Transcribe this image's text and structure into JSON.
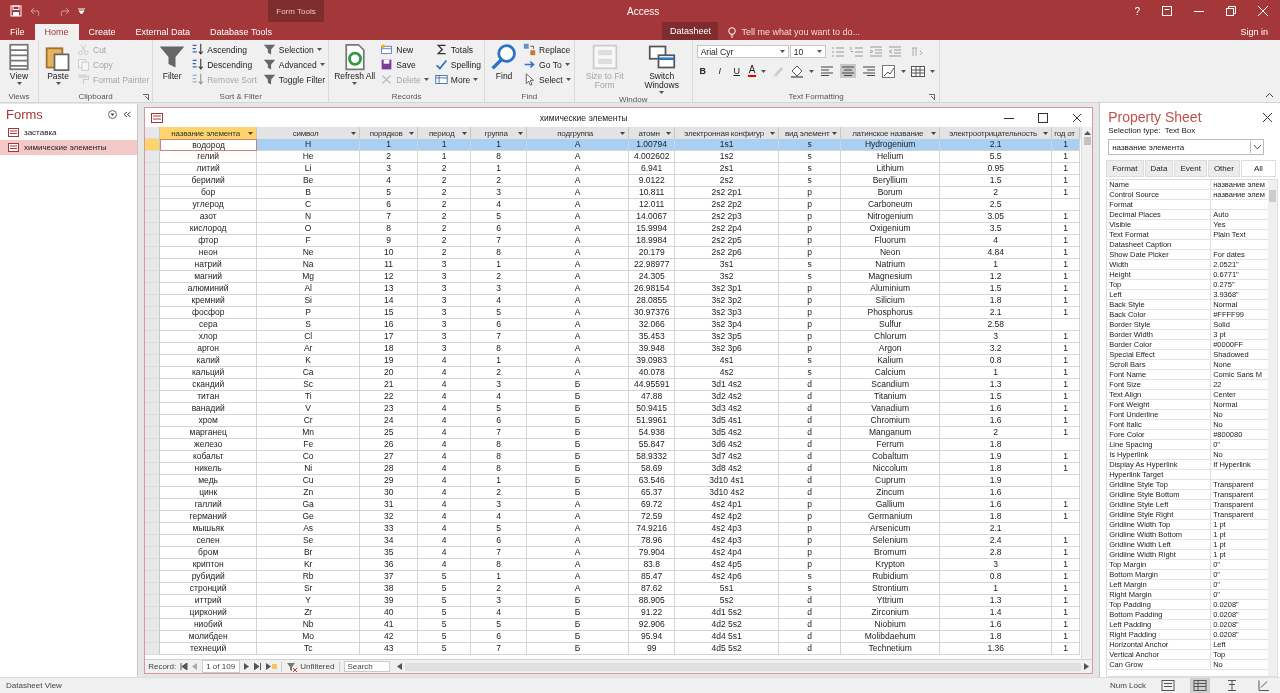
{
  "window": {
    "title": "Access",
    "context_header": "Form Tools",
    "sign_in": "Sign in",
    "help": "?"
  },
  "tabs": [
    {
      "label": "File",
      "selected": false,
      "kind": "plain"
    },
    {
      "label": "Home",
      "selected": true,
      "kind": "plain"
    },
    {
      "label": "Create",
      "selected": false,
      "kind": "plain"
    },
    {
      "label": "External Data",
      "selected": false,
      "kind": "plain"
    },
    {
      "label": "Database Tools",
      "selected": false,
      "kind": "plain"
    },
    {
      "label": "Datasheet",
      "selected": false,
      "kind": "context"
    }
  ],
  "tell_me": {
    "placeholder": "Tell me what you want to do..."
  },
  "ribbon": {
    "groups": [
      {
        "label": "Views",
        "launcher": false,
        "items": [
          {
            "kind": "large",
            "label": "View",
            "menu": true,
            "disabled": false
          }
        ]
      },
      {
        "label": "Clipboard",
        "launcher": true,
        "items": [
          {
            "kind": "large",
            "label": "Paste",
            "menu": true,
            "disabled": false
          },
          {
            "kind": "small",
            "label": "Cut",
            "menu": false,
            "disabled": true
          },
          {
            "kind": "small",
            "label": "Copy",
            "menu": false,
            "disabled": true
          },
          {
            "kind": "small",
            "label": "Format Painter",
            "menu": false,
            "disabled": true
          }
        ]
      },
      {
        "label": "Sort & Filter",
        "launcher": false,
        "items": [
          {
            "kind": "large",
            "label": "Filter",
            "menu": false,
            "disabled": false
          },
          {
            "kind": "small",
            "label": "Ascending",
            "menu": false,
            "disabled": false
          },
          {
            "kind": "small",
            "label": "Descending",
            "menu": false,
            "disabled": false
          },
          {
            "kind": "small",
            "label": "Remove Sort",
            "menu": false,
            "disabled": true
          },
          {
            "kind": "small",
            "label": "Selection",
            "menu": true,
            "disabled": false
          },
          {
            "kind": "small",
            "label": "Advanced",
            "menu": true,
            "disabled": false
          },
          {
            "kind": "small",
            "label": "Toggle Filter",
            "menu": false,
            "disabled": false
          }
        ]
      },
      {
        "label": "Records",
        "launcher": false,
        "items": [
          {
            "kind": "large",
            "label": "Refresh All",
            "menu": true,
            "disabled": false
          },
          {
            "kind": "small",
            "label": "New",
            "menu": false,
            "disabled": false
          },
          {
            "kind": "small",
            "label": "Save",
            "menu": false,
            "disabled": false
          },
          {
            "kind": "small",
            "label": "Delete",
            "menu": true,
            "disabled": true
          },
          {
            "kind": "small",
            "label": "Totals",
            "menu": false,
            "disabled": false
          },
          {
            "kind": "small",
            "label": "Spelling",
            "menu": false,
            "disabled": false
          },
          {
            "kind": "small",
            "label": "More",
            "menu": true,
            "disabled": false
          }
        ]
      },
      {
        "label": "Find",
        "launcher": false,
        "items": [
          {
            "kind": "large",
            "label": "Find",
            "menu": false,
            "disabled": false
          },
          {
            "kind": "small",
            "label": "Replace",
            "menu": false,
            "disabled": false
          },
          {
            "kind": "small",
            "label": "Go To",
            "menu": true,
            "disabled": false
          },
          {
            "kind": "small",
            "label": "Select",
            "menu": true,
            "disabled": false
          }
        ]
      },
      {
        "label": "Window",
        "launcher": false,
        "items": [
          {
            "kind": "large",
            "label": "Size to Fit Form",
            "menu": false,
            "disabled": true
          },
          {
            "kind": "large",
            "label": "Switch Windows",
            "menu": true,
            "disabled": false
          }
        ]
      }
    ],
    "text_formatting": {
      "label": "Text Formatting",
      "launcher": true,
      "font": "Arial Cyr",
      "size": "10",
      "styles": [
        "B",
        "I",
        "U"
      ],
      "font_color_button": "A",
      "alignments": [
        {
          "selected": false
        },
        {
          "selected": true
        },
        {
          "selected": false
        }
      ]
    }
  },
  "nav_pane": {
    "title": "Forms",
    "items": [
      {
        "label": "заставка",
        "selected": false
      },
      {
        "label": "химические элементы",
        "selected": true
      }
    ]
  },
  "document": {
    "title": "химические элементы",
    "columns": [
      {
        "label": "название элемента",
        "selected": true
      },
      {
        "label": "символ",
        "selected": false
      },
      {
        "label": "порядков",
        "selected": false
      },
      {
        "label": "период",
        "selected": false
      },
      {
        "label": "группа",
        "selected": false
      },
      {
        "label": "подгруппа",
        "selected": false
      },
      {
        "label": "атомн",
        "selected": false
      },
      {
        "label": "электронная конфигур",
        "selected": false
      },
      {
        "label": "вид элемент",
        "selected": false
      },
      {
        "label": "латинское название",
        "selected": false
      },
      {
        "label": "электроотрицательность",
        "selected": false
      },
      {
        "label": "год от",
        "selected": false
      }
    ],
    "rows": [
      {
        "selected": true,
        "cells": [
          "водород",
          "H",
          "1",
          "1",
          "1",
          "А",
          "1.00794",
          "1s1",
          "s",
          "Hydrogenium",
          "2.1",
          "1"
        ]
      },
      {
        "selected": false,
        "cells": [
          "гелий",
          "He",
          "2",
          "1",
          "8",
          "А",
          "4.002602",
          "1s2",
          "s",
          "Helium",
          "5.5",
          "1"
        ]
      },
      {
        "selected": false,
        "cells": [
          "литий",
          "Li",
          "3",
          "2",
          "1",
          "А",
          "6.941",
          "2s1",
          "s",
          "Lithium",
          "0.95",
          "1"
        ]
      },
      {
        "selected": false,
        "cells": [
          "берилий",
          "Be",
          "4",
          "2",
          "2",
          "А",
          "9.0122",
          "2s2",
          "s",
          "Beryllium",
          "1.5",
          "1"
        ]
      },
      {
        "selected": false,
        "cells": [
          "бор",
          "B",
          "5",
          "2",
          "3",
          "А",
          "10.811",
          "2s2 2p1",
          "p",
          "Borum",
          "2",
          "1"
        ]
      },
      {
        "selected": false,
        "cells": [
          "углерод",
          "C",
          "6",
          "2",
          "4",
          "А",
          "12.011",
          "2s2 2p2",
          "p",
          "Carboneum",
          "2.5",
          null
        ]
      },
      {
        "selected": false,
        "cells": [
          "азот",
          "N",
          "7",
          "2",
          "5",
          "А",
          "14.0067",
          "2s2 2p3",
          "p",
          "Nitrogenium",
          "3.05",
          "1"
        ]
      },
      {
        "selected": false,
        "cells": [
          "кислород",
          "O",
          "8",
          "2",
          "6",
          "А",
          "15.9994",
          "2s2 2p4",
          "p",
          "Oxigenium",
          "3.5",
          "1"
        ]
      },
      {
        "selected": false,
        "cells": [
          "фтор",
          "F",
          "9",
          "2",
          "7",
          "А",
          "18.9984",
          "2s2 2p5",
          "p",
          "Fluorum",
          "4",
          "1"
        ]
      },
      {
        "selected": false,
        "cells": [
          "неон",
          "Ne",
          "10",
          "2",
          "8",
          "А",
          "20.179",
          "2s2 2p6",
          "p",
          "Neon",
          "4.84",
          "1"
        ]
      },
      {
        "selected": false,
        "cells": [
          "натрий",
          "Na",
          "11",
          "3",
          "1",
          "А",
          "22.98977",
          "3s1",
          "s",
          "Natrium",
          "1",
          "1"
        ]
      },
      {
        "selected": false,
        "cells": [
          "магний",
          "Mg",
          "12",
          "3",
          "2",
          "А",
          "24.305",
          "3s2",
          "s",
          "Magnesium",
          "1.2",
          "1"
        ]
      },
      {
        "selected": false,
        "cells": [
          "алюминий",
          "Al",
          "13",
          "3",
          "3",
          "А",
          "26.98154",
          "3s2 3p1",
          "p",
          "Aluminium",
          "1.5",
          "1"
        ]
      },
      {
        "selected": false,
        "cells": [
          "кремний",
          "Si",
          "14",
          "3",
          "4",
          "А",
          "28.0855",
          "3s2 3p2",
          "p",
          "Silicium",
          "1.8",
          "1"
        ]
      },
      {
        "selected": false,
        "cells": [
          "фосфор",
          "P",
          "15",
          "3",
          "5",
          "А",
          "30.97376",
          "3s2 3p3",
          "p",
          "Phosphorus",
          "2.1",
          "1"
        ]
      },
      {
        "selected": false,
        "cells": [
          "сера",
          "S",
          "16",
          "3",
          "6",
          "А",
          "32.066",
          "3s2 3p4",
          "p",
          "Sulfur",
          "2.58",
          null
        ]
      },
      {
        "selected": false,
        "cells": [
          "хлор",
          "Cl",
          "17",
          "3",
          "7",
          "А",
          "35.453",
          "3s2 3p5",
          "p",
          "Chlorum",
          "3",
          "1"
        ]
      },
      {
        "selected": false,
        "cells": [
          "аргон",
          "Ar",
          "18",
          "3",
          "8",
          "А",
          "39.948",
          "3s2 3p6",
          "p",
          "Argon",
          "3.2",
          "1"
        ]
      },
      {
        "selected": false,
        "cells": [
          "калий",
          "K",
          "19",
          "4",
          "1",
          "А",
          "39.0983",
          "4s1",
          "s",
          "Kalium",
          "0.8",
          "1"
        ]
      },
      {
        "selected": false,
        "cells": [
          "кальций",
          "Ca",
          "20",
          "4",
          "2",
          "А",
          "40.078",
          "4s2",
          "s",
          "Calcium",
          "1",
          "1"
        ]
      },
      {
        "selected": false,
        "cells": [
          "скандий",
          "Sc",
          "21",
          "4",
          "3",
          "Б",
          "44.95591",
          "3d1 4s2",
          "d",
          "Scandium",
          "1.3",
          "1"
        ]
      },
      {
        "selected": false,
        "cells": [
          "титан",
          "Ti",
          "22",
          "4",
          "4",
          "Б",
          "47.88",
          "3d2 4s2",
          "d",
          "Titanium",
          "1.5",
          "1"
        ]
      },
      {
        "selected": false,
        "cells": [
          "ванадий",
          "V",
          "23",
          "4",
          "5",
          "Б",
          "50.9415",
          "3d3 4s2",
          "d",
          "Vanadium",
          "1.6",
          "1"
        ]
      },
      {
        "selected": false,
        "cells": [
          "хром",
          "Cr",
          "24",
          "4",
          "6",
          "Б",
          "51.9961",
          "3d5 4s1",
          "d",
          "Chromium",
          "1.6",
          "1"
        ]
      },
      {
        "selected": false,
        "cells": [
          "марганец",
          "Mn",
          "25",
          "4",
          "7",
          "Б",
          "54.938",
          "3d5 4s2",
          "d",
          "Manganum",
          "2",
          "1"
        ]
      },
      {
        "selected": false,
        "cells": [
          "железо",
          "Fe",
          "26",
          "4",
          "8",
          "Б",
          "55.847",
          "3d6 4s2",
          "d",
          "Ferrum",
          "1.8",
          null
        ]
      },
      {
        "selected": false,
        "cells": [
          "кобальт",
          "Co",
          "27",
          "4",
          "8",
          "Б",
          "58.9332",
          "3d7 4s2",
          "d",
          "Cobaltum",
          "1.9",
          "1"
        ]
      },
      {
        "selected": false,
        "cells": [
          "никель",
          "Ni",
          "28",
          "4",
          "8",
          "Б",
          "58.69",
          "3d8 4s2",
          "d",
          "Niccolum",
          "1.8",
          "1"
        ]
      },
      {
        "selected": false,
        "cells": [
          "медь",
          "Cu",
          "29",
          "4",
          "1",
          "Б",
          "63.546",
          "3d10 4s1",
          "d",
          "Cuprum",
          "1.9",
          null
        ]
      },
      {
        "selected": false,
        "cells": [
          "цинк",
          "Zn",
          "30",
          "4",
          "2",
          "Б",
          "65.37",
          "3d10 4s2",
          "d",
          "Zincum",
          "1.6",
          null
        ]
      },
      {
        "selected": false,
        "cells": [
          "галлий",
          "Ga",
          "31",
          "4",
          "3",
          "А",
          "69.72",
          "4s2 4p1",
          "p",
          "Gallium",
          "1.6",
          "1"
        ]
      },
      {
        "selected": false,
        "cells": [
          "германий",
          "Ge",
          "32",
          "4",
          "4",
          "А",
          "72.59",
          "4s2 4p2",
          "p",
          "Germanium",
          "1.8",
          "1"
        ]
      },
      {
        "selected": false,
        "cells": [
          "мышьяк",
          "As",
          "33",
          "4",
          "5",
          "А",
          "74.9216",
          "4s2 4p3",
          "p",
          "Arsenicum",
          "2.1",
          null
        ]
      },
      {
        "selected": false,
        "cells": [
          "селен",
          "Se",
          "34",
          "4",
          "6",
          "А",
          "78.96",
          "4s2 4p3",
          "p",
          "Selenium",
          "2.4",
          "1"
        ]
      },
      {
        "selected": false,
        "cells": [
          "бром",
          "Br",
          "35",
          "4",
          "7",
          "А",
          "79.904",
          "4s2 4p4",
          "p",
          "Bromum",
          "2.8",
          "1"
        ]
      },
      {
        "selected": false,
        "cells": [
          "криптон",
          "Kr",
          "36",
          "4",
          "8",
          "А",
          "83.8",
          "4s2 4p5",
          "p",
          "Krypton",
          "3",
          "1"
        ]
      },
      {
        "selected": false,
        "cells": [
          "рубидий",
          "Rb",
          "37",
          "5",
          "1",
          "А",
          "85.47",
          "4s2 4p6",
          "s",
          "Rubidium",
          "0.8",
          "1"
        ]
      },
      {
        "selected": false,
        "cells": [
          "стронций",
          "Sr",
          "38",
          "5",
          "2",
          "А",
          "87.62",
          "5s1",
          "s",
          "Strontium",
          "1",
          "1"
        ]
      },
      {
        "selected": false,
        "cells": [
          "иттрий",
          "Y",
          "39",
          "5",
          "3",
          "Б",
          "88.905",
          "5s2",
          "d",
          "Yttrium",
          "1.3",
          "1"
        ]
      },
      {
        "selected": false,
        "cells": [
          "цирконий",
          "Zr",
          "40",
          "5",
          "4",
          "Б",
          "91.22",
          "4d1 5s2",
          "d",
          "Zirconium",
          "1.4",
          "1"
        ]
      },
      {
        "selected": false,
        "cells": [
          "ниобий",
          "Nb",
          "41",
          "5",
          "5",
          "Б",
          "92.906",
          "4d2 5s2",
          "d",
          "Niobium",
          "1.6",
          "1"
        ]
      },
      {
        "selected": false,
        "cells": [
          "молибден",
          "Mo",
          "42",
          "5",
          "6",
          "Б",
          "95.94",
          "4d4 5s1",
          "d",
          "Molibdaehum",
          "1.8",
          "1"
        ]
      },
      {
        "selected": false,
        "cells": [
          "технеций",
          "Tc",
          "43",
          "5",
          "7",
          "Б",
          "99",
          "4d5 5s2",
          "d",
          "Technetium",
          "1.36",
          "1"
        ]
      }
    ],
    "record_nav": {
      "label": "Record:",
      "position": "1 of 109",
      "filter": "Unfiltered",
      "search": {
        "placeholder": "Search"
      }
    }
  },
  "property_sheet": {
    "title": "Property Sheet",
    "selection_type_label": "Selection type:",
    "selection_type": "Text Box",
    "object": "название элемента",
    "tabs": [
      {
        "label": "Format",
        "selected": false
      },
      {
        "label": "Data",
        "selected": false
      },
      {
        "label": "Event",
        "selected": false
      },
      {
        "label": "Other",
        "selected": false
      },
      {
        "label": "All",
        "selected": true
      }
    ],
    "properties": [
      {
        "name": "Name",
        "value": "название элем"
      },
      {
        "name": "Control Source",
        "value": "название элем"
      },
      {
        "name": "Format"
      },
      {
        "name": "Decimal Places",
        "value": "Auto"
      },
      {
        "name": "Visible",
        "value": "Yes"
      },
      {
        "name": "Text Format",
        "value": "Plain Text"
      },
      {
        "name": "Datasheet Caption"
      },
      {
        "name": "Show Date Picker",
        "value": "For dates"
      },
      {
        "name": "Width",
        "value": "2.0521\""
      },
      {
        "name": "Height",
        "value": "0.6771\""
      },
      {
        "name": "Top",
        "value": "0.275\""
      },
      {
        "name": "Left",
        "value": "3.9368\""
      },
      {
        "name": "Back Style",
        "value": "Normal"
      },
      {
        "name": "Back Color",
        "value": "#FFFF99"
      },
      {
        "name": "Border Style",
        "value": "Solid"
      },
      {
        "name": "Border Width",
        "value": "3 pt"
      },
      {
        "name": "Border Color",
        "value": "#0000FF"
      },
      {
        "name": "Special Effect",
        "value": "Shadowed"
      },
      {
        "name": "Scroll Bars",
        "value": "None"
      },
      {
        "name": "Font Name",
        "value": "Comic Sans M"
      },
      {
        "name": "Font Size",
        "value": "22"
      },
      {
        "name": "Text Align",
        "value": "Center"
      },
      {
        "name": "Font Weight",
        "value": "Normal"
      },
      {
        "name": "Font Underline",
        "value": "No"
      },
      {
        "name": "Font Italic",
        "value": "No"
      },
      {
        "name": "Fore Color",
        "value": "#800080"
      },
      {
        "name": "Line Spacing",
        "value": "0\""
      },
      {
        "name": "Is Hyperlink",
        "value": "No"
      },
      {
        "name": "Display As Hyperlink",
        "value": "If Hyperlink"
      },
      {
        "name": "Hyperlink Target"
      },
      {
        "name": "Gridline Style Top",
        "value": "Transparent"
      },
      {
        "name": "Gridline Style Bottom",
        "value": "Transparent"
      },
      {
        "name": "Gridline Style Left",
        "value": "Transparent"
      },
      {
        "name": "Gridline Style Right",
        "value": "Transparent"
      },
      {
        "name": "Gridline Width Top",
        "value": "1 pt"
      },
      {
        "name": "Gridline Width Bottom",
        "value": "1 pt"
      },
      {
        "name": "Gridline Width Left",
        "value": "1 pt"
      },
      {
        "name": "Gridline Width Right",
        "value": "1 pt"
      },
      {
        "name": "Top Margin",
        "value": "0\""
      },
      {
        "name": "Bottom Margin",
        "value": "0\""
      },
      {
        "name": "Left Margin",
        "value": "0\""
      },
      {
        "name": "Right Margin",
        "value": "0\""
      },
      {
        "name": "Top Padding",
        "value": "0.0208\""
      },
      {
        "name": "Bottom Padding",
        "value": "0.0208\""
      },
      {
        "name": "Left Padding",
        "value": "0.0208\""
      },
      {
        "name": "Right Padding",
        "value": "0.0208\""
      },
      {
        "name": "Horizontal Anchor",
        "value": "Left"
      },
      {
        "name": "Vertical Anchor",
        "value": "Top"
      },
      {
        "name": "Can Grow",
        "value": "No"
      }
    ]
  },
  "status_bar": {
    "view": "Datasheet View",
    "num_lock": "Num Lock",
    "views": [
      {
        "selected": false
      },
      {
        "selected": true
      },
      {
        "selected": false
      },
      {
        "selected": false
      }
    ]
  }
}
